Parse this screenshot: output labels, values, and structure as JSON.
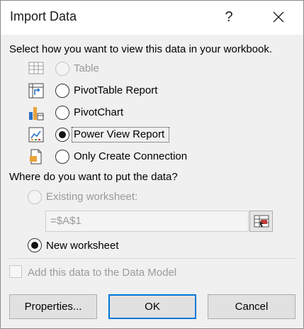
{
  "dialog": {
    "title": "Import Data",
    "help_glyph": "?",
    "prompt_view": "Select how you want to view this data in your workbook.",
    "view_options": [
      {
        "label": "Table",
        "state": "disabled",
        "icon": "table-icon"
      },
      {
        "label": "PivotTable Report",
        "state": "unselected",
        "icon": "pivottable-icon"
      },
      {
        "label": "PivotChart",
        "state": "unselected",
        "icon": "pivotchart-icon"
      },
      {
        "label": "Power View Report",
        "state": "selected",
        "icon": "powerview-icon"
      },
      {
        "label": "Only Create Connection",
        "state": "unselected",
        "icon": "connection-icon"
      }
    ],
    "prompt_location": "Where do you want to put the data?",
    "existing_worksheet_label": "Existing worksheet:",
    "existing_worksheet_value": "=$A$1",
    "new_worksheet_label": "New worksheet",
    "data_model_label": "Add this data to the Data Model",
    "buttons": {
      "properties": "Properties...",
      "ok": "OK",
      "cancel": "Cancel"
    },
    "colors": {
      "accent": "#0078d7",
      "background": "#f0f0f0",
      "disabled_text": "#9a9a9a"
    }
  }
}
